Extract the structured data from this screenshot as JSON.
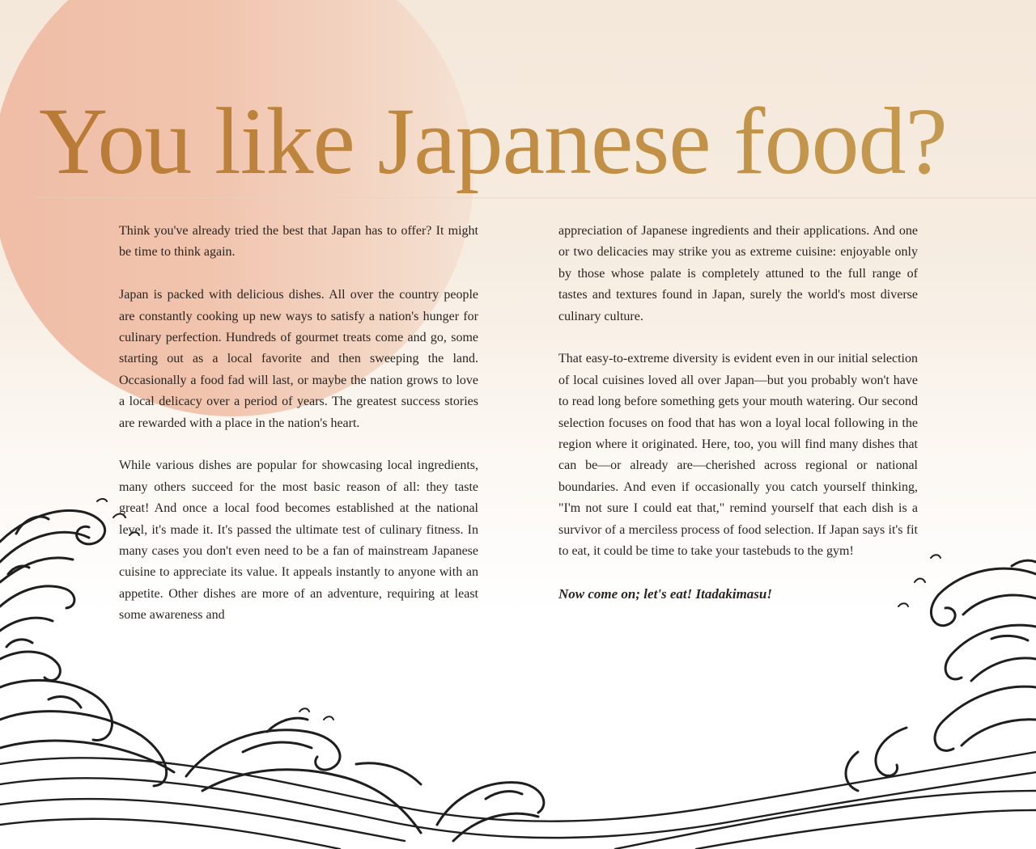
{
  "title": "You like Japanese food?",
  "colors": {
    "title_gold": "#c08a40",
    "sun_coral": "#f0bda6",
    "body_text": "#2a2420",
    "wave_ink": "#1e1e1e"
  },
  "left_column": {
    "paragraphs": [
      "Think you've already tried the best that Japan has to offer? It might be time to think again.",
      "Japan is packed with delicious dishes. All over the country people are constantly cooking up new ways to satisfy a nation's hunger for culinary perfection. Hundreds of gourmet treats come and go, some starting out as a local favorite and then sweeping the land. Occasionally a food fad will last, or maybe the nation grows to love a local delicacy over a period of years. The greatest success stories are rewarded with a place in the nation's heart.",
      "While various dishes are popular for showcasing local ingredients, many others succeed for the most basic reason of all: they taste great! And once a local food becomes established at the national level, it's made it. It's passed the ultimate test of culinary fitness. In many cases you don't even need to be a fan of mainstream Japanese cuisine to appreciate its value. It appeals instantly to anyone with an appetite. Other dishes are more of an adventure, requiring at least some awareness and"
    ]
  },
  "right_column": {
    "paragraphs": [
      "appreciation of Japanese ingredients and their applications. And one or two delicacies may strike you as extreme cuisine: enjoyable only by those whose palate is completely attuned to the full range of tastes and textures found in Japan, surely the world's most diverse culinary culture.",
      "That easy-to-extreme diversity is evident even in our initial selection of local cuisines loved all over Japan—but you probably won't have to read long before something gets your mouth watering. Our second selection focuses on food that has won a loyal local following in the region where it originated. Here, too, you will find many dishes that can be—or already are—cherished across regional or national boundaries. And even if occasionally you catch yourself thinking, \"I'm not sure I could eat that,\" remind yourself that each dish is a survivor of a merciless process of food selection. If Japan says it's fit to eat, it could be time to take your tastebuds to the gym!"
    ],
    "closing": "Now come on; let's eat! Itadakimasu!"
  },
  "illustration": {
    "sun_icon": "red-sun-circle",
    "waves_icon": "ukiyo-e-waves"
  }
}
